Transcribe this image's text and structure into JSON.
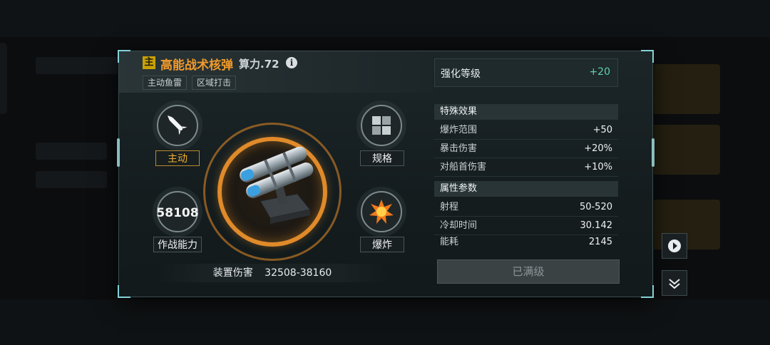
{
  "header": {
    "main_badge": "主",
    "title": "高能战术核弹",
    "power": "算力.72",
    "info_glyph": "i",
    "tags": [
      "主动鱼雷",
      "区域打击"
    ]
  },
  "stats": {
    "mode_label": "主动",
    "spec_label": "规格",
    "combat_value": "58108",
    "combat_label": "作战能力",
    "effect_label": "爆炸"
  },
  "damage": {
    "label": "装置伤害",
    "value": "32508-38160"
  },
  "enhance": {
    "label": "强化等级",
    "value": "+20"
  },
  "special_effects": {
    "title": "特殊效果",
    "rows": [
      {
        "name": "爆炸范围",
        "value": "+50"
      },
      {
        "name": "暴击伤害",
        "value": "+20%"
      },
      {
        "name": "对船首伤害",
        "value": "+10%"
      }
    ]
  },
  "attributes": {
    "title": "属性参数",
    "rows": [
      {
        "name": "射程",
        "value": "50-520"
      },
      {
        "name": "冷却时间",
        "value": "30.142"
      },
      {
        "name": "能耗",
        "value": "2145"
      }
    ]
  },
  "maxed_button": "已满级",
  "icons": {
    "mode": "missile-icon",
    "spec": "grid-blocks-icon",
    "effect": "explosion-icon",
    "play": "play-icon",
    "collapse": "collapse-chevron-icon"
  },
  "colors": {
    "title_orange": "#f09a2a",
    "enhance_green": "#5fd0a8",
    "badge_gold": "#c9a000"
  }
}
